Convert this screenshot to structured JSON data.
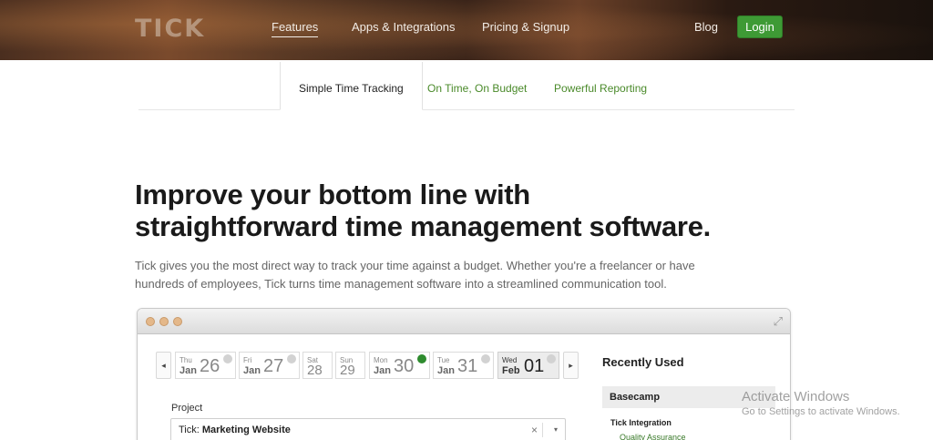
{
  "header": {
    "logo": "TICK",
    "nav": [
      "Features",
      "Apps & Integrations",
      "Pricing & Signup"
    ],
    "blog": "Blog",
    "login": "Login"
  },
  "tabs": [
    "Simple Time Tracking",
    "On Time, On Budget",
    "Powerful Reporting"
  ],
  "hero": {
    "headline_bold": "Improve your bottom line",
    "headline_rest1": " with",
    "headline_line2": "straightforward time management software.",
    "intro": "Tick gives you the most direct way to track your time against a budget. Whether you're a freelancer or have hundreds of employees, Tick turns time management software into a streamlined communication tool."
  },
  "app": {
    "days": [
      {
        "wd": "Thu",
        "mo": "Jan",
        "num": "26",
        "status": "empty"
      },
      {
        "wd": "Fri",
        "mo": "Jan",
        "num": "27",
        "status": "empty"
      },
      {
        "wd": "Sat",
        "mo": "",
        "num": "28",
        "status": "none"
      },
      {
        "wd": "Sun",
        "mo": "",
        "num": "29",
        "status": "none"
      },
      {
        "wd": "Mon",
        "mo": "Jan",
        "num": "30",
        "status": "done"
      },
      {
        "wd": "Tue",
        "mo": "Jan",
        "num": "31",
        "status": "empty"
      },
      {
        "wd": "Wed",
        "mo": "Feb",
        "num": "01",
        "status": "empty"
      }
    ],
    "prev_arrow": "◂",
    "next_arrow": "▸",
    "project_label": "Project",
    "project_prefix": "Tick: ",
    "project_value": "Marketing Website",
    "clear_glyph": "×",
    "caret_glyph": "▾",
    "expand_glyph": "⤢",
    "recent_title": "Recently Used",
    "recent_client": "Basecamp",
    "recent_group": "Tick Integration",
    "recent_task": "Quality Assurance"
  },
  "watermark": {
    "title": "Activate Windows",
    "sub": "Go to Settings to activate Windows."
  },
  "colors": {
    "accent_green": "#3e9a35",
    "link_green": "#4a8a2a",
    "status_done": "#2e8b2e"
  }
}
